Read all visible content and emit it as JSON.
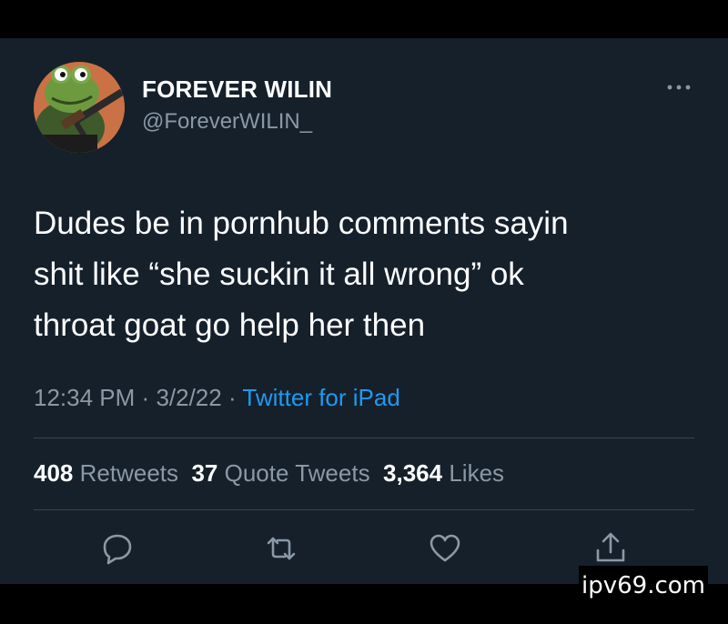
{
  "user": {
    "display_name": "FOREVER WILIN",
    "handle": "@ForeverWILIN_",
    "avatar_icon": "frog-avatar-icon"
  },
  "tweet": {
    "lines": [
      "Dudes be in pornhub comments sayin",
      "shit like “she suckin it all wrong” ok",
      "throat goat go help her then"
    ],
    "time": "12:34 PM",
    "date": "3/2/22",
    "separator": "·",
    "source": "Twitter for iPad"
  },
  "stats": {
    "retweets_count": "408",
    "retweets_label": "Retweets",
    "quotes_count": "37",
    "quotes_label": "Quote Tweets",
    "likes_count": "3,364",
    "likes_label": "Likes"
  },
  "actions": {
    "reply_icon": "reply-icon",
    "retweet_icon": "retweet-icon",
    "like_icon": "heart-icon",
    "share_icon": "share-icon",
    "more_icon": "more-options-icon"
  },
  "watermark": "ipv69.com",
  "colors": {
    "background": "#15202b",
    "text_primary": "#ffffff",
    "text_secondary": "#8b98a5",
    "accent": "#1d9bf0",
    "divider": "#38444d"
  }
}
